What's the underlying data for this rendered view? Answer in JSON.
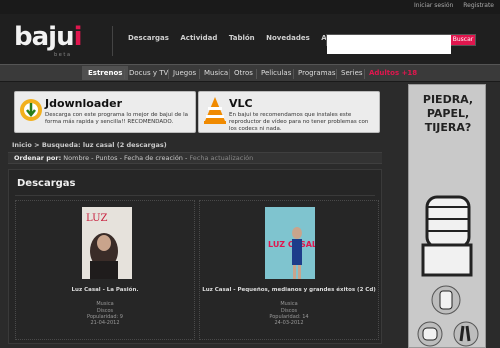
{
  "top_links": {
    "login": "Iniciar sesión",
    "register": "Registrate"
  },
  "header": {
    "logo_main": "baju",
    "logo_accent": "i",
    "logo_sub": "b e t a"
  },
  "main_nav": [
    "Descargas",
    "Actividad",
    "Tablón",
    "Novedades",
    "Ayuda"
  ],
  "search": {
    "placeholder": "",
    "button": "Buscar"
  },
  "sub_nav": [
    "Estrenos",
    "Docus y TV",
    "Juegos",
    "Musica",
    "Otros",
    "Peliculas",
    "Programas",
    "Series",
    "Adultos +18"
  ],
  "promos": [
    {
      "title": "Jdownloader",
      "desc": "Descarga con este programa lo mejor de bajui de la forma más rapida y sencilla!! RECOMENDADO."
    },
    {
      "title": "VLC",
      "desc": "En bajui te recomendamos que instales este reproductor de vídeo para no tener problemas con los codecs ni nada."
    }
  ],
  "breadcrumb": {
    "home": "Inicio",
    "sep": ">",
    "current": "Busqueda: luz casal (2 descargas)"
  },
  "order": {
    "label": "Ordenar por:",
    "options": [
      "Nombre",
      "Puntos",
      "Fecha de creación"
    ],
    "muted": "Fecha actualización"
  },
  "downloads": {
    "heading": "Descargas",
    "items": [
      {
        "title": "Luz Casal - La Pasión.",
        "category": "Musica",
        "type": "Discos",
        "popularity": "Popularidad: 9",
        "date": "21-04-2012"
      },
      {
        "title": "Luz Casal - Pequeños, medianos y grandes éxitos (2 Cd)",
        "category": "Musica",
        "type": "Discos",
        "popularity": "Popularidad: 14",
        "date": "24-03-2012"
      }
    ]
  },
  "ad": {
    "text": "PIEDRA, PAPEL, TIJERA?"
  },
  "colors": {
    "accent": "#e0164e",
    "background": "#2b2b2b"
  }
}
